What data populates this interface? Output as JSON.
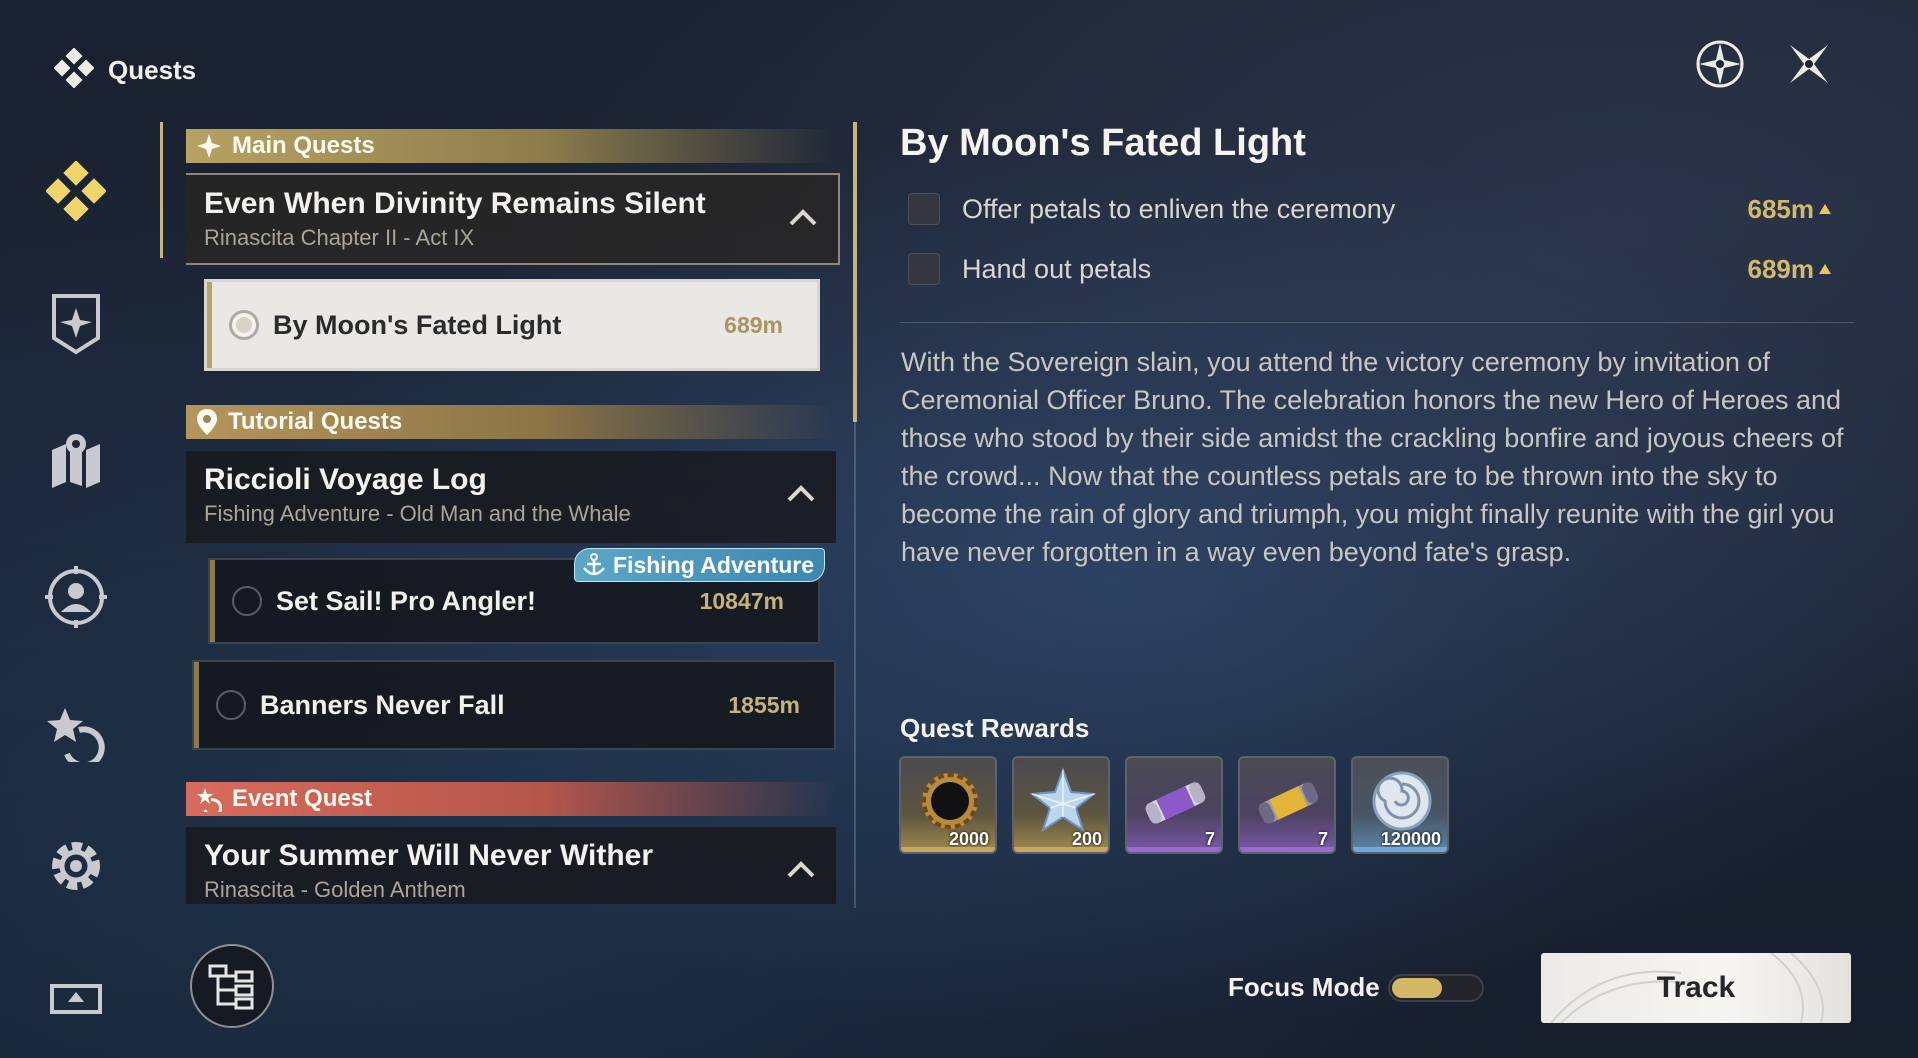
{
  "app": {
    "title": "Quests"
  },
  "categories": {
    "main": "Main Quests",
    "tutorial": "Tutorial Quests",
    "event": "Event Quest"
  },
  "groups": [
    {
      "title": "Even When Divinity Remains Silent",
      "subtitle": "Rinascita Chapter II - Act IX"
    },
    {
      "title": "Riccioli Voyage Log",
      "subtitle": "Fishing Adventure - Old Man and the Whale"
    },
    {
      "title": "Your Summer Will Never Wither",
      "subtitle": "Rinascita - Golden Anthem"
    }
  ],
  "quests": [
    {
      "title": "By Moon's Fated Light",
      "distance": "689m"
    },
    {
      "title": "Set Sail! Pro Angler!",
      "distance": "10847m",
      "badge": "Fishing Adventure"
    },
    {
      "title": "Banners Never Fall",
      "distance": "1855m"
    }
  ],
  "detail": {
    "title": "By Moon's Fated Light",
    "objectives": [
      {
        "text": "Offer petals to enliven the ceremony",
        "distance": "685m"
      },
      {
        "text": "Hand out petals",
        "distance": "689m"
      }
    ],
    "description": "With the Sovereign slain, you attend the victory ceremony by invitation of Ceremonial Officer Bruno. The celebration honors the new Hero of Heroes and those who stood by their side amidst the crackling bonfire and joyous cheers of the crowd... Now that the countless petals are to be thrown into the sky to become the rain of glory and triumph, you might finally reunite with the girl you have never forgotten in a way even beyond fate's grasp.",
    "rewards_label": "Quest Rewards",
    "rewards": [
      {
        "icon": "black-ring-icon",
        "qty": "2000",
        "rarity_color": "#c9a65a"
      },
      {
        "icon": "star-crystal-icon",
        "qty": "200",
        "rarity_color": "#c9a65a"
      },
      {
        "icon": "purple-capsule-icon",
        "qty": "7",
        "rarity_color": "#9a6ad0"
      },
      {
        "icon": "gold-capsule-icon",
        "qty": "7",
        "rarity_color": "#9a6ad0"
      },
      {
        "icon": "shell-coin-icon",
        "qty": "120000",
        "rarity_color": "#6fa7d6"
      }
    ]
  },
  "footer": {
    "focus_mode_label": "Focus Mode",
    "focus_mode_on": true,
    "track_label": "Track"
  },
  "colors": {
    "gold_accent": "#c9b47a",
    "distance": "#d3b96c",
    "event_red": "#d86b5c"
  }
}
